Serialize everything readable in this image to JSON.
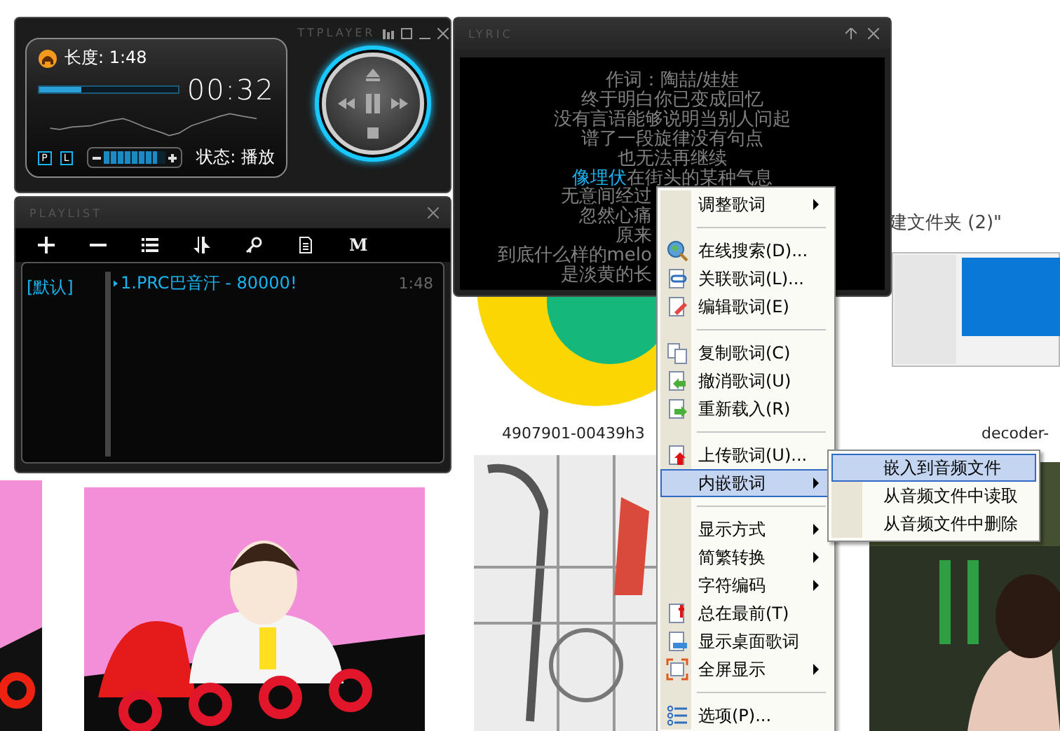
{
  "explorer": {
    "folder_title": "建文件夹 (2)\"",
    "file_labels": [
      "4907901-00439h3",
      "decoder-"
    ]
  },
  "player": {
    "brand": "TTPLAYER",
    "length": "长度: 1:48",
    "progress": {
      "level": 0.3
    },
    "time": "00:32",
    "mode_buttons": [
      "P",
      "L"
    ],
    "volume": {
      "level": 0.85
    },
    "status": "状态: 播放"
  },
  "playlist": {
    "title": "PLAYLIST",
    "mode_button": "M",
    "groups": [
      {
        "name": "[默认]",
        "selected": true
      }
    ],
    "tracks": [
      {
        "title": "1.PRC巴音汗 - 80000!",
        "duration": "1:48",
        "playing": true
      }
    ]
  },
  "lyric": {
    "title": "LYRIC",
    "lines": [
      {
        "text": "作词：陶喆/娃娃"
      },
      {
        "text": "终于明白你已变成回忆"
      },
      {
        "text": "没有言语能够说明当别人问起"
      },
      {
        "text": "谱了一段旋律没有句点"
      },
      {
        "text": "也无法再继续"
      },
      {
        "sung": "像埋伏",
        "text": "在街头的某种气息"
      }
    ],
    "lines_under_menu": [
      {
        "text": "无意间经过"
      },
      {
        "text": "忽然心痛"
      },
      {
        "text": "原来"
      },
      {
        "text": "到底什么样的melo"
      },
      {
        "text": "是淡黄的长"
      }
    ]
  },
  "context_menu": {
    "items": [
      {
        "kind": "item",
        "label": "调整歌词",
        "submenu": true,
        "selected": false
      },
      {
        "kind": "separator"
      },
      {
        "kind": "item",
        "label": "在线搜索(D)...",
        "submenu": false,
        "selected": false
      },
      {
        "kind": "item",
        "label": "关联歌词(L)...",
        "submenu": false,
        "selected": false
      },
      {
        "kind": "item",
        "label": "编辑歌词(E)",
        "submenu": false,
        "selected": false
      },
      {
        "kind": "separator"
      },
      {
        "kind": "item",
        "label": "复制歌词(C)",
        "submenu": false,
        "selected": false
      },
      {
        "kind": "item",
        "label": "撤消歌词(U)",
        "submenu": false,
        "selected": false
      },
      {
        "kind": "item",
        "label": "重新载入(R)",
        "submenu": false,
        "selected": false
      },
      {
        "kind": "separator"
      },
      {
        "kind": "item",
        "label": "上传歌词(U)...",
        "submenu": false,
        "selected": false
      },
      {
        "kind": "item",
        "label": "内嵌歌词",
        "submenu": true,
        "selected": true
      },
      {
        "kind": "separator"
      },
      {
        "kind": "item",
        "label": "显示方式",
        "submenu": true,
        "selected": false
      },
      {
        "kind": "item",
        "label": "简繁转换",
        "submenu": true,
        "selected": false
      },
      {
        "kind": "item",
        "label": "字符编码",
        "submenu": true,
        "selected": false
      },
      {
        "kind": "item",
        "label": "总在最前(T)",
        "submenu": false,
        "selected": false
      },
      {
        "kind": "item",
        "label": "显示桌面歌词",
        "submenu": false,
        "selected": false
      },
      {
        "kind": "item",
        "label": "全屏显示",
        "submenu": true,
        "selected": false
      },
      {
        "kind": "separator"
      },
      {
        "kind": "item",
        "label": "选项(P)...",
        "submenu": false,
        "selected": false
      }
    ]
  },
  "submenu": {
    "items": [
      {
        "label": "嵌入到音频文件",
        "selected": true
      },
      {
        "label": "从音频文件中读取",
        "selected": false
      },
      {
        "label": "从音频文件中删除",
        "selected": false
      }
    ]
  }
}
